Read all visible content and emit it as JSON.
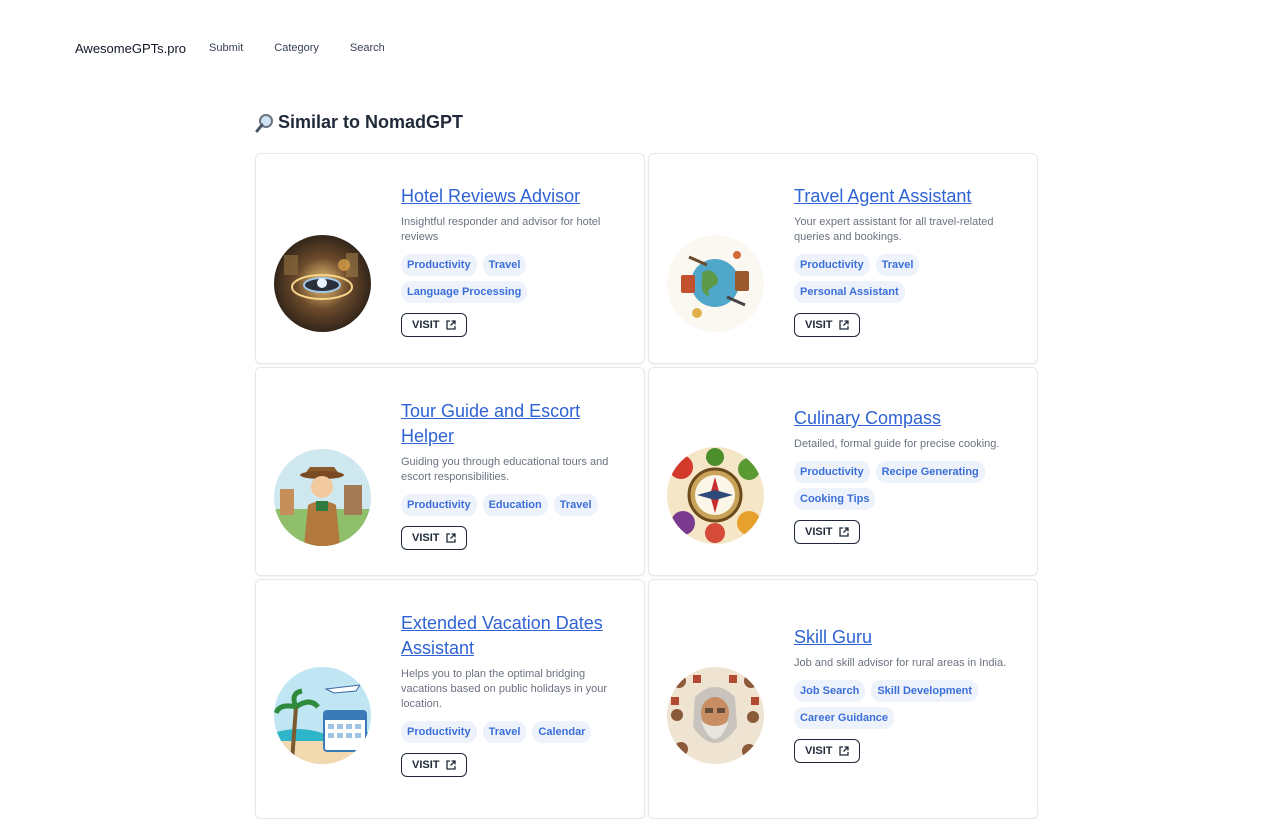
{
  "nav": {
    "brand": "AwesomeGPTs.pro",
    "links": [
      "Submit",
      "Category",
      "Search"
    ]
  },
  "heading": "Similar to NomadGPT",
  "visit_label": "VISIT",
  "cards": [
    {
      "title": "Hotel Reviews Advisor",
      "description": "Insightful responder and advisor for hotel reviews",
      "tags": [
        "Productivity",
        "Travel",
        "Language Processing"
      ],
      "thumb": "hotel-tech-image"
    },
    {
      "title": "Travel Agent Assistant",
      "description": "Your expert assistant for all travel-related queries and bookings.",
      "tags": [
        "Productivity",
        "Travel",
        "Personal Assistant"
      ],
      "thumb": "globe-travel-image"
    },
    {
      "title": "Tour Guide and Escort Helper",
      "description": "Guiding you through educational tours and escort responsibilities.",
      "tags": [
        "Productivity",
        "Education",
        "Travel"
      ],
      "thumb": "tour-guide-image"
    },
    {
      "title": "Culinary Compass",
      "description": "Detailed, formal guide for precise cooking.",
      "tags": [
        "Productivity",
        "Recipe Generating",
        "Cooking Tips"
      ],
      "thumb": "compass-food-image"
    },
    {
      "title": "Extended Vacation Dates Assistant",
      "description": "Helps you to plan the optimal bridging vacations based on public holidays in your location.",
      "tags": [
        "Productivity",
        "Travel",
        "Calendar"
      ],
      "thumb": "beach-calendar-image"
    },
    {
      "title": "Skill Guru",
      "description": "Job and skill advisor for rural areas in India.",
      "tags": [
        "Job Search",
        "Skill Development",
        "Career Guidance"
      ],
      "thumb": "guru-image"
    }
  ]
}
